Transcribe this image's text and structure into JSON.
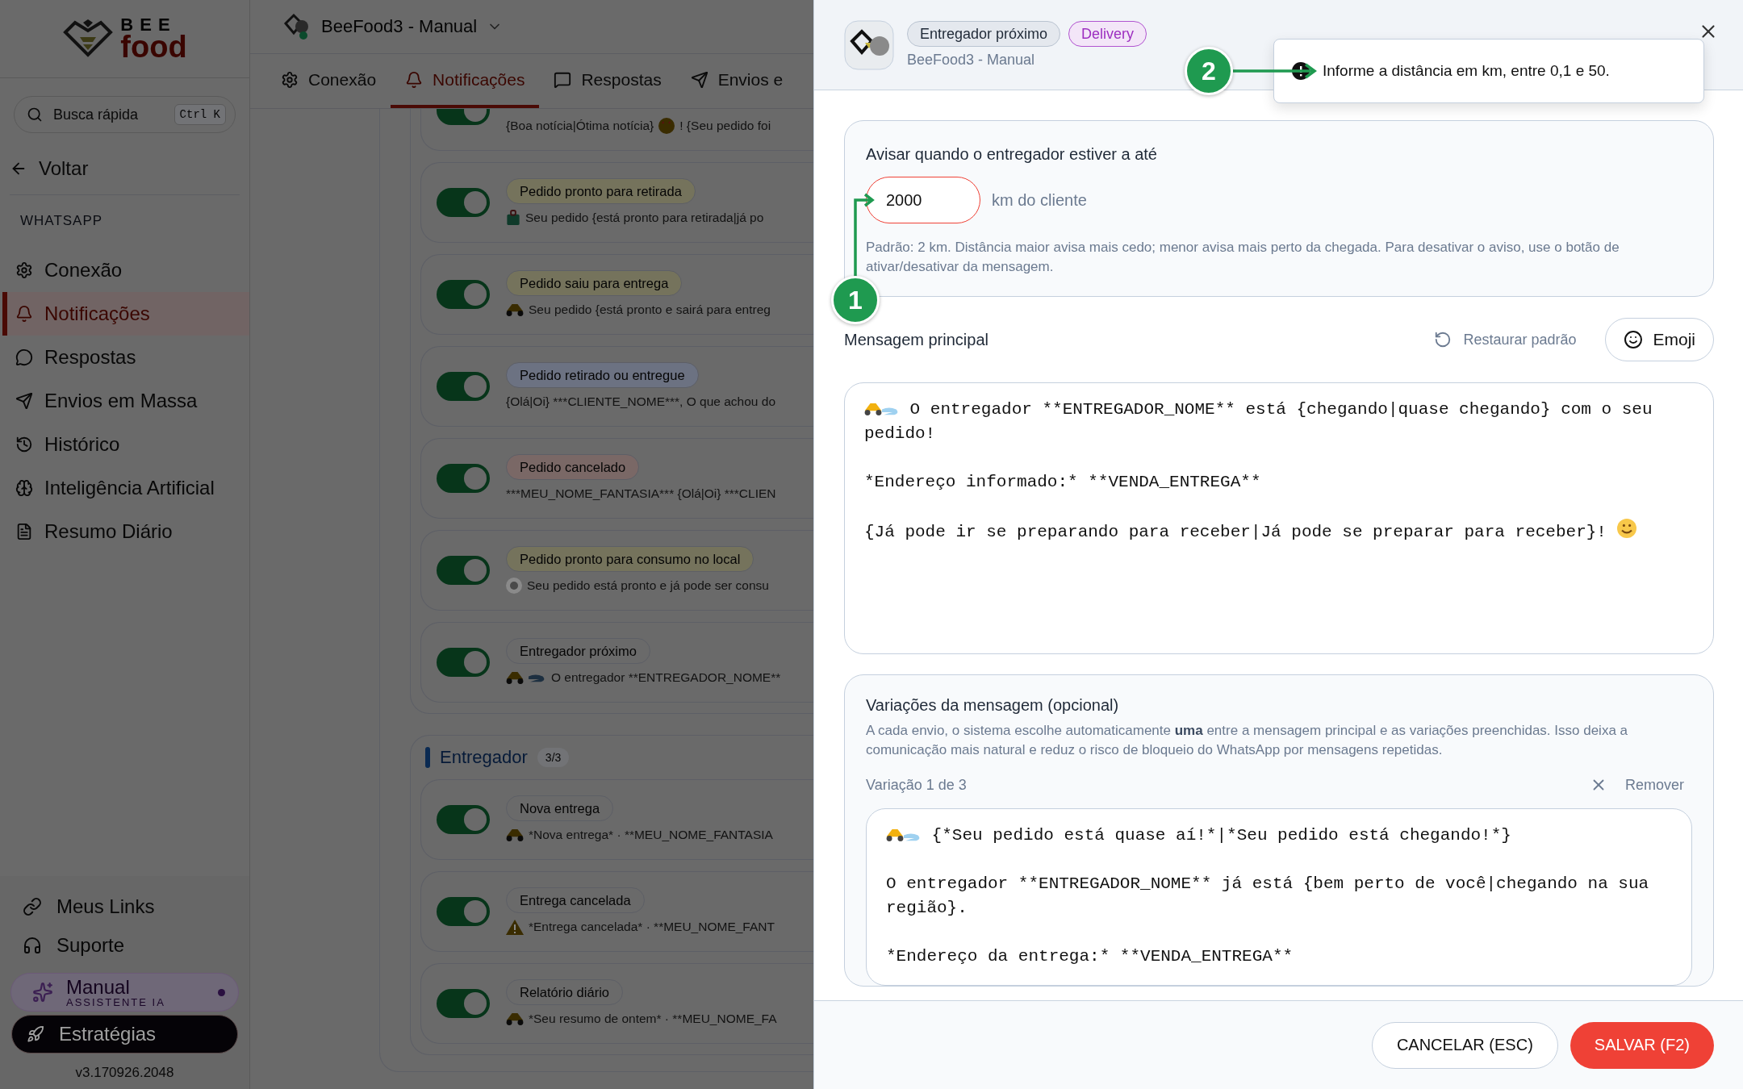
{
  "sidebar": {
    "brand_top": "BEE",
    "brand_bottom": "food",
    "search": {
      "placeholder": "Busca rápida",
      "shortcut": "Ctrl K"
    },
    "back": "Voltar",
    "section": "WHATSAPP",
    "items": [
      {
        "label": "Conexão",
        "selected": false
      },
      {
        "label": "Notificações",
        "selected": true
      },
      {
        "label": "Respostas",
        "selected": false
      },
      {
        "label": "Envios em Massa",
        "selected": false
      },
      {
        "label": "Histórico",
        "selected": false
      },
      {
        "label": "Inteligência Artificial",
        "selected": false
      },
      {
        "label": "Resumo Diário",
        "selected": false
      }
    ],
    "links": [
      "Meus Links",
      "Suporte"
    ],
    "assistant": {
      "name": "Manual",
      "subtitle": "ASSISTENTE IA"
    },
    "strategies": "Estratégias",
    "version": "v3.170926.2048"
  },
  "store": {
    "name": "BeeFood3 - Manual"
  },
  "tabs": [
    {
      "label": "Conexão",
      "selected": false
    },
    {
      "label": "Notificações",
      "selected": true
    },
    {
      "label": "Respostas",
      "selected": false
    },
    {
      "label": "Envios e",
      "selected": false
    }
  ],
  "groups": [
    {
      "items": [
        {
          "preview": "{Boa notícia|Ótima notícia}",
          "preview_after": "! {Seu pedido foi",
          "on": true
        },
        {
          "label": "Pedido pronto para retirada",
          "color": "#75735c",
          "preview": "Seu pedido {está pronto para retirada|já po",
          "on": true
        },
        {
          "label": "Pedido saiu para entrega",
          "color": "#75735c",
          "preview": "Seu pedido {está pronto e sairá para entreg",
          "on": true
        },
        {
          "label": "Pedido retirado ou entregue",
          "color": "#6c7282",
          "preview": "{Olá|Oi} ***CLIENTE_NOME***, O que achou do",
          "on": true
        },
        {
          "label": "Pedido cancelado",
          "color": "#7a6866",
          "preview": "***MEU_NOME_FANTASIA*** {Olá|Oi} ***CLIEN",
          "on": true
        },
        {
          "label": "Pedido pronto para consumo no local",
          "color": "#75735c",
          "preview": "Seu pedido está pronto e já pode ser consu",
          "on": true
        },
        {
          "label": "Entregador próximo",
          "color": "#6a6a6a",
          "preview": "O entregador **ENTREGADOR_NOME**",
          "on": true
        }
      ]
    },
    {
      "title": "Entregador",
      "count": "3/3",
      "items": [
        {
          "label": "Nova entrega",
          "color": "#6a6a6a",
          "preview": "*Nova entrega* · **MEU_NOME_FANTASIA",
          "on": true
        },
        {
          "label": "Entrega cancelada",
          "color": "#6a6a6a",
          "preview": "*Entrega cancelada* · **MEU_NOME_FANT",
          "on": true
        },
        {
          "label": "Relatório diário",
          "color": "#6a6a6a",
          "preview": "*Seu resumo de ontem* · **MEU_NOME_FA",
          "on": true
        }
      ]
    }
  ],
  "drawer": {
    "chips": [
      {
        "label": "Entregador próximo",
        "kind": "neutral"
      },
      {
        "label": "Delivery",
        "kind": "accent"
      }
    ],
    "subtitle": "BeeFood3 - Manual",
    "tooltip": "Informe a distância em km, entre 0,1 e 50.",
    "distance": {
      "label": "Avisar quando o entregador estiver a até",
      "value": "2000",
      "invalid": true,
      "unit": "km do cliente",
      "help": "Padrão: 2 km. Distância maior avisa mais cedo; menor avisa mais perto da chegada. Para desativar o aviso, use o botão de ativar/desativar da mensagem."
    },
    "message": {
      "label": "Mensagem principal",
      "restore": "Restaurar padrão",
      "emoji": "Emoji",
      "value": "O entregador **ENTREGADOR_NOME** está {chegando|quase chegando} com o seu pedido!\n\n*Endereço informado:* **VENDA_ENTREGA**\n\n{Já pode ir se preparando para receber|Já pode se preparar para receber}!"
    },
    "variations": {
      "title": "Variações da mensagem (opcional)",
      "description": "A cada envio, o sistema escolhe automaticamente **uma** entre a mensagem principal e as variações preenchidas. Isso deixa a comunicação mais natural e reduz o risco de bloqueio do WhatsApp por mensagens repetidas.",
      "counter": "Variação 1 de 3",
      "remove": "Remover",
      "value": "{*Seu pedido está quase aí!*|*Seu pedido está chegando!*}\n\nO entregador **ENTREGADOR_NOME** já está {bem perto de você|chegando na sua região}.\n\n*Endereço da entrega:* **VENDA_ENTREGA**"
    },
    "footer": {
      "cancel": "CANCELAR (ESC)",
      "save": "SALVAR (F2)"
    }
  },
  "annotations": [
    {
      "label": "1"
    },
    {
      "label": "2"
    }
  ]
}
